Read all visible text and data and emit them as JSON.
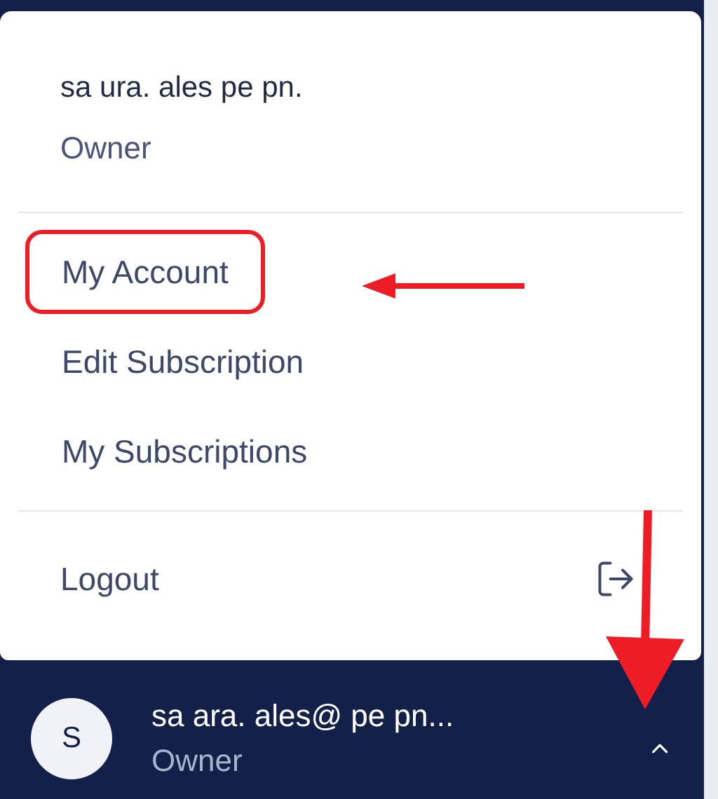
{
  "menu": {
    "email": "sa ura. ales pe pn.",
    "role": "Owner",
    "items": [
      {
        "label": "My Account",
        "highlighted": true
      },
      {
        "label": "Edit Subscription",
        "highlighted": false
      },
      {
        "label": "My Subscriptions",
        "highlighted": false
      }
    ],
    "logout": "Logout"
  },
  "user": {
    "initial": "S",
    "email": "sa ara. ales@ pe pn...",
    "role": "Owner",
    "expanded": true
  }
}
